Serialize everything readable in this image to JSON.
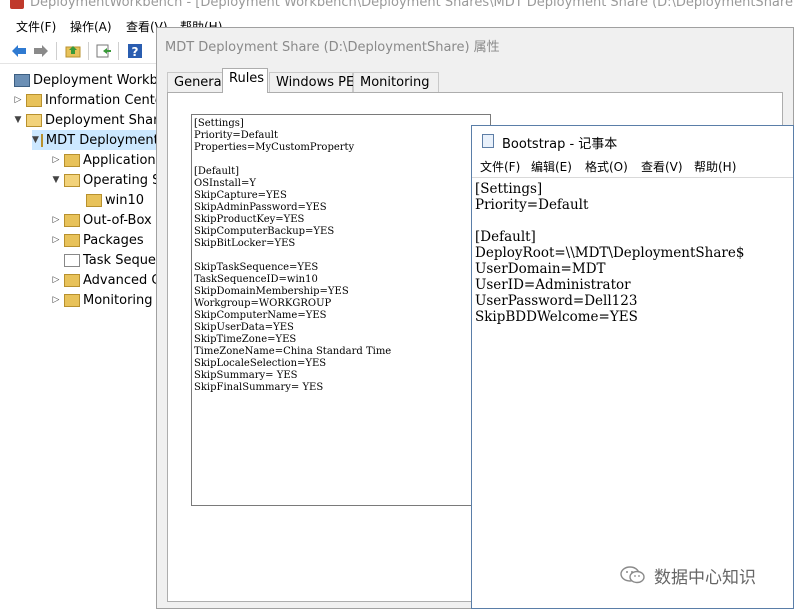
{
  "main_window": {
    "title": "DeploymentWorkbench - [Deployment Workbench\\Deployment Shares\\MDT Deployment Share (D:\\DeploymentShare)]",
    "menu": [
      "文件(F)",
      "操作(A)",
      "查看(V)",
      "帮助(H)"
    ],
    "toolbar_icons": [
      "back-arrow-icon",
      "forward-arrow-icon",
      "up-folder-icon",
      "export-icon",
      "help-icon"
    ]
  },
  "tree": {
    "items": [
      {
        "label": "Deployment Workbench",
        "icon": "workbench-root-icon"
      },
      {
        "label": "Information Center",
        "icon": "folder-icon"
      },
      {
        "label": "Deployment Shares",
        "icon": "folder-open-icon"
      },
      {
        "label": "MDT Deployment Share (D:\\DeploymentShare)",
        "icon": "folder-open-icon"
      },
      {
        "label": "Applications",
        "icon": "folder-icon"
      },
      {
        "label": "Operating Systems",
        "icon": "folder-open-icon"
      },
      {
        "label": "win10",
        "icon": "folder-icon"
      },
      {
        "label": "Out-of-Box Drivers",
        "icon": "folder-icon"
      },
      {
        "label": "Packages",
        "icon": "folder-icon"
      },
      {
        "label": "Task Sequences",
        "icon": "folder-icon"
      },
      {
        "label": "Advanced Configuration",
        "icon": "folder-icon"
      },
      {
        "label": "Monitoring",
        "icon": "folder-icon"
      }
    ]
  },
  "properties_dialog": {
    "title": "MDT Deployment Share (D:\\DeploymentShare) 属性",
    "tabs": [
      "General",
      "Rules",
      "Windows PE",
      "Monitoring"
    ],
    "active_tab": "Rules",
    "rules_text": "[Settings]\nPriority=Default\nProperties=MyCustomProperty\n\n[Default]\nOSInstall=Y\nSkipCapture=YES\nSkipAdminPassword=YES\nSkipProductKey=YES\nSkipComputerBackup=YES\nSkipBitLocker=YES\n\nSkipTaskSequence=YES\nTaskSequenceID=win10\nSkipDomainMembership=YES\nWorkgroup=WORKGROUP\nSkipComputerName=YES\nSkipUserData=YES\nSkipTimeZone=YES\nTimeZoneName=China Standard Time\nSkipLocaleSelection=YES\nSkipSummary= YES\nSkipFinalSummary= YES"
  },
  "notepad": {
    "title": "Bootstrap - 记事本",
    "menu": [
      "文件(F)",
      "编辑(E)",
      "格式(O)",
      "查看(V)",
      "帮助(H)"
    ],
    "text": "[Settings]\nPriority=Default\n\n[Default]\nDeployRoot=\\\\MDT\\DeploymentShare$\nUserDomain=MDT\nUserID=Administrator\nUserPassword=Dell123\nSkipBDDWelcome=YES"
  },
  "watermark": {
    "text": "数据中心知识"
  }
}
